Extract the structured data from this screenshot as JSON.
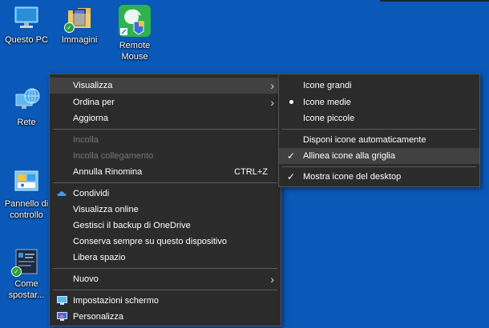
{
  "desktop": {
    "icons": [
      {
        "label": "Questo PC",
        "icon": "computer-icon"
      },
      {
        "label": "Immagini",
        "icon": "pictures-folder-icon"
      },
      {
        "label": "Remote\nMouse",
        "icon": "remote-mouse-icon"
      },
      {
        "label": "Rete",
        "icon": "network-globe-icon"
      },
      {
        "label": "Pannello di\ncontrollo",
        "icon": "control-panel-icon"
      },
      {
        "label": "Come\nspostar...",
        "icon": "screenshot-file-icon"
      }
    ]
  },
  "context_menu": {
    "view": "Visualizza",
    "sort_by": "Ordina per",
    "refresh": "Aggiorna",
    "paste": "Incolla",
    "paste_shortcut": "Incolla collegamento",
    "undo_rename": "Annulla Rinomina",
    "undo_shortcut": "CTRL+Z",
    "share": "Condividi",
    "view_online": "Visualizza online",
    "manage_backup": "Gestisci il backup di OneDrive",
    "keep_on_device": "Conserva sempre su questo dispositivo",
    "free_space": "Libera spazio",
    "new": "Nuovo",
    "display_settings": "Impostazioni schermo",
    "personalize": "Personalizza"
  },
  "view_submenu": {
    "large_icons": "Icone grandi",
    "medium_icons": "Icone medie",
    "small_icons": "Icone piccole",
    "auto_arrange": "Disponi icone automaticamente",
    "align_to_grid": "Allinea icone alla griglia",
    "show_desktop_icons": "Mostra icone del desktop",
    "selected_size": "Icone medie"
  },
  "colors": {
    "desktop_bg": "#0a58b8",
    "menu_bg": "#2b2b2b",
    "menu_hover": "#414141",
    "onedrive_blue": "#3f9be8"
  }
}
